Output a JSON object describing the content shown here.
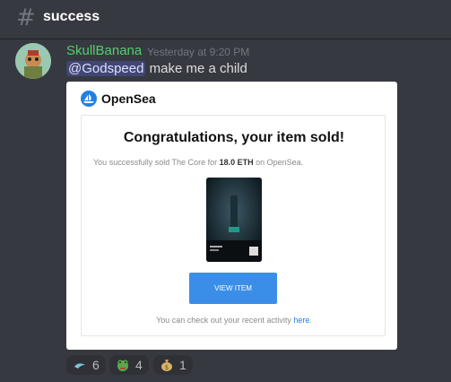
{
  "channel": {
    "symbol": "#",
    "name": "success"
  },
  "message": {
    "author": "SkullBanana",
    "timestamp": "Yesterday at 9:20 PM",
    "mention": "@Godspeed",
    "text": " make me a child"
  },
  "embed": {
    "brand": "OpenSea",
    "title": "Congratulations, your item sold!",
    "sub_prefix": "You successfully sold The Core for ",
    "price": "18.0 ETH",
    "sub_suffix": " on OpenSea.",
    "button_label": "VIEW ITEM",
    "footer_prefix": "You can check out your recent activity ",
    "footer_link": "here",
    "footer_suffix": "."
  },
  "reactions": [
    {
      "icon": "wave-emoji",
      "count": "6"
    },
    {
      "icon": "frog-emoji",
      "count": "4"
    },
    {
      "icon": "money-bag-emoji",
      "count": "1"
    }
  ]
}
